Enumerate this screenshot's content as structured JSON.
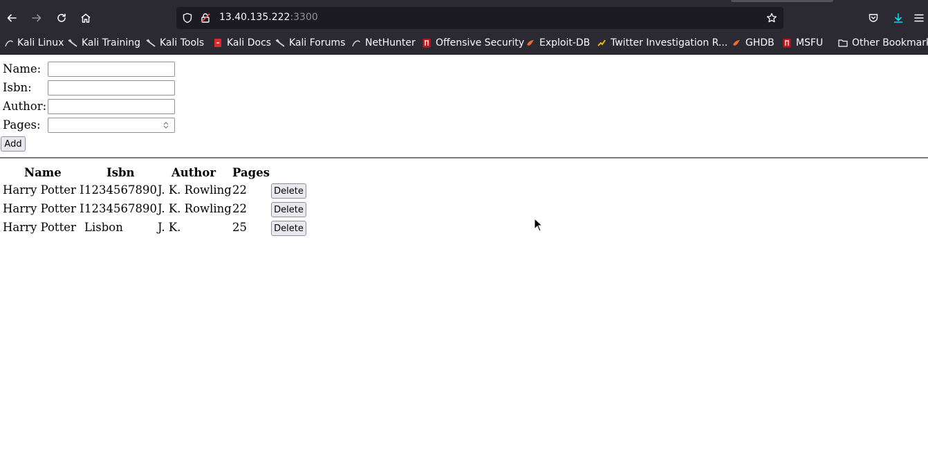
{
  "browser": {
    "url_host": "13.40.135.222",
    "url_port": ":3300",
    "bookmarks": [
      "Kali Linux",
      "Kali Training",
      "Kali Tools",
      "Kali Docs",
      "Kali Forums",
      "NetHunter",
      "Offensive Security",
      "Exploit-DB",
      "Twitter Investigation R...",
      "GHDB",
      "MSFU",
      "Other Bookmarks"
    ]
  },
  "form": {
    "name_label": "Name:",
    "isbn_label": "Isbn:",
    "author_label": "Author:",
    "pages_label": "Pages:",
    "name_value": "",
    "isbn_value": "",
    "author_value": "",
    "pages_value": "",
    "add_label": "Add"
  },
  "table": {
    "headers": [
      "Name",
      "Isbn",
      "Author",
      "Pages"
    ],
    "rows": [
      {
        "name": "Harry Potter I",
        "isbn": "1234567890",
        "author": "J. K. Rowling",
        "pages": "22",
        "delete": "Delete"
      },
      {
        "name": "Harry Potter I",
        "isbn": "1234567890",
        "author": "J. K. Rowling",
        "pages": "22",
        "delete": "Delete"
      },
      {
        "name": "Harry Potter",
        "isbn": "Lisbon",
        "author": "J. K.",
        "pages": "25",
        "delete": "Delete"
      }
    ]
  }
}
